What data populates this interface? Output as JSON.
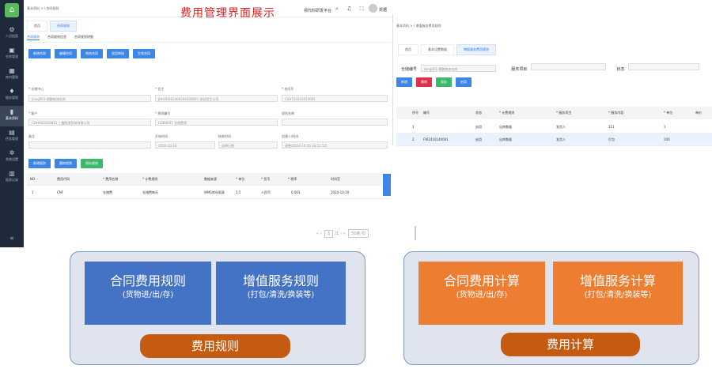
{
  "banner": "费用管理界面展示",
  "app1": {
    "breadcrumb": "基本资料 > / 合同规则",
    "platform": "领代科研发平台",
    "username": "票据",
    "sidebar": [
      {
        "label": "人员档案"
      },
      {
        "label": "仓库管理"
      },
      {
        "label": "库内管理"
      },
      {
        "label": "服务管理"
      },
      {
        "label": "基本资料"
      },
      {
        "label": "任务管理"
      },
      {
        "label": "系统设置"
      },
      {
        "label": "报表记录"
      }
    ],
    "tabs": [
      {
        "label": "首页"
      },
      {
        "label": "合同规则"
      }
    ],
    "subtabs": [
      {
        "label": "合同规则"
      },
      {
        "label": "合同规则信息"
      },
      {
        "label": "合同规则明细"
      }
    ],
    "buttons": [
      {
        "label": "新增合同"
      },
      {
        "label": "编辑合同"
      },
      {
        "label": "审核合同"
      },
      {
        "label": "驳回审核"
      },
      {
        "label": "生效合同"
      }
    ],
    "form": {
      "warehouse_label": "* 仓储中心",
      "warehouse_value": "jiang001-德鹏物流仓库",
      "contract_label": "* 货主",
      "contract_value": "JHHZH202406204300001 测试货主公司",
      "contract_no_label": "* 合同号",
      "contract_no_value": "CSHT20241010001",
      "customer_label": "* 客户",
      "customer_value": "CDHH20220815 三鑫物流贸易有限公司",
      "code_label": "* 规则编号",
      "code_value": "CGB4001 仓储费规",
      "remark_label": "规则名称",
      "note_label": "备注",
      "start_label": "开始时间",
      "start_value": "2024-10-10",
      "end_label": "结束时间",
      "end_value": "选择日期",
      "created_label": "创建人/时间",
      "created_value": "调整(2024-10-10 16:12:52)"
    },
    "table_buttons": [
      {
        "label": "新增规则"
      },
      {
        "label": "删除规则"
      },
      {
        "label": "保存规则"
      }
    ],
    "table_headers": [
      "NO",
      "费用代码",
      "* 费用名称",
      "* 计费规则",
      "数据来源",
      "* 单位",
      "* 货币",
      "* 税率",
      "时间范"
    ],
    "row": {
      "no": "1",
      "code": "CNF",
      "name": "仓储费",
      "rule": "仓储费每天",
      "source": "WMS库存报表",
      "price": "1.5",
      "currency": "人民币",
      "rate": "0.003",
      "date": "2024-10-10"
    },
    "pager": {
      "page": "1",
      "total": "/1",
      "per": "50条/页"
    }
  },
  "app2": {
    "breadcrumb": "基本资料 > / 增值服务费用规则",
    "tabs": [
      {
        "label": "首页"
      },
      {
        "label": "基本设置数据"
      },
      {
        "label": "增值服务费用规则"
      }
    ],
    "warehouse_label": "仓储编号",
    "warehouse_value": "jiang001-德鹏物流仓库",
    "service_label": "服务项目",
    "status_label": "状态",
    "buttons": [
      {
        "label": "新增"
      },
      {
        "label": "删除"
      },
      {
        "label": "保存"
      },
      {
        "label": "启用"
      }
    ],
    "headers": [
      "序号",
      "编号",
      "状态",
      "* 计费规则",
      "* 服务项目",
      "* 服务内容",
      "* 单位",
      "单价"
    ],
    "rows": [
      {
        "no": "1",
        "code": "",
        "status": "启用",
        "rule": "出库数量",
        "item": "发货人",
        "content": "111",
        "unit": "1"
      },
      {
        "no": "2",
        "code": "FW2410140001",
        "status": "启用",
        "rule": "出库数量",
        "item": "发货人",
        "content": "打包",
        "unit": "100"
      }
    ]
  },
  "panels": {
    "rules": {
      "box1_title": "合同费用规则",
      "box1_sub": "(货物进/出/存)",
      "box2_title": "增值服务规则",
      "box2_sub": "(打包/清洗/换装等)",
      "pill": "费用规则"
    },
    "calc": {
      "box1_title": "合同费用计算",
      "box1_sub": "(货物进/出/存)",
      "box2_title": "增值服务计算",
      "box2_sub": "(打包/清洗/换装等)",
      "pill": "费用计算"
    }
  },
  "colors": {
    "blue_box": "#4472c4",
    "orange_box": "#ed7d31",
    "pill": "#c55a11",
    "panel": "#dfe4ee"
  }
}
